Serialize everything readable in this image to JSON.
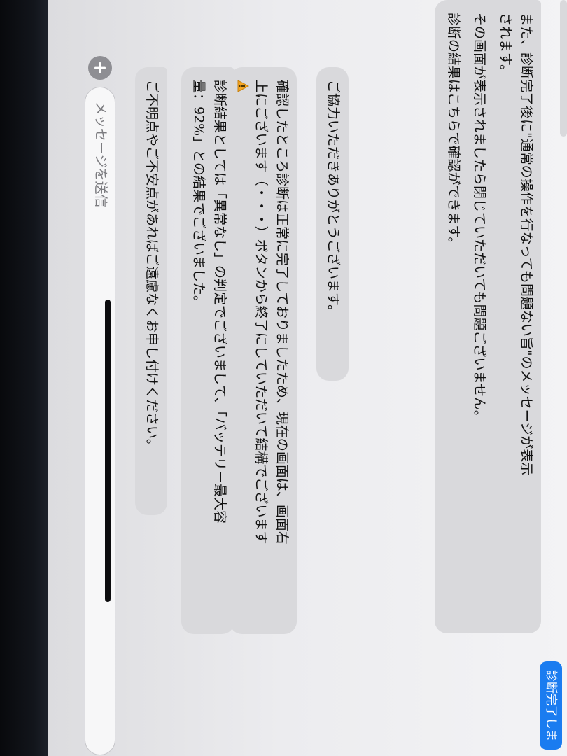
{
  "chat": {
    "message_1": {
      "lines": [
        "また、診断完了後に\"通常の操作を行なっても問題ない旨\"のメッセージが表示",
        "されます。",
        "その画面が表示されましたら閉じていただいても問題ございません。",
        "診断の結果はこちらで確認ができます。"
      ]
    },
    "message_2": {
      "text": "ご協力いただきありがとうございます。"
    },
    "message_3": {
      "lines": [
        "確認したところ診断は正常に完了しておりましたため、現在の画面は、画面右",
        "上にございます（・・・）ボタンから終了にしていただいて結構でございます"
      ],
      "icon": "warning-triangle-icon"
    },
    "message_4": {
      "lines": [
        "診断結果としては「異常なし」の判定でございまして、「バッテリー最大容",
        "量：92%」との結果でございました。"
      ]
    },
    "message_5": {
      "text": "ご不明点やご不安点があればご遠慮なくお申し付けください。"
    },
    "blue_tag": {
      "text": "診断完了しま"
    }
  },
  "composer": {
    "placeholder": "メッセージを送信",
    "plus_icon": "plus-icon"
  },
  "colors": {
    "bubble_gray": "#d9d9dc",
    "accent_blue": "#1a7cf0",
    "plus_button": "#8e8e93"
  }
}
